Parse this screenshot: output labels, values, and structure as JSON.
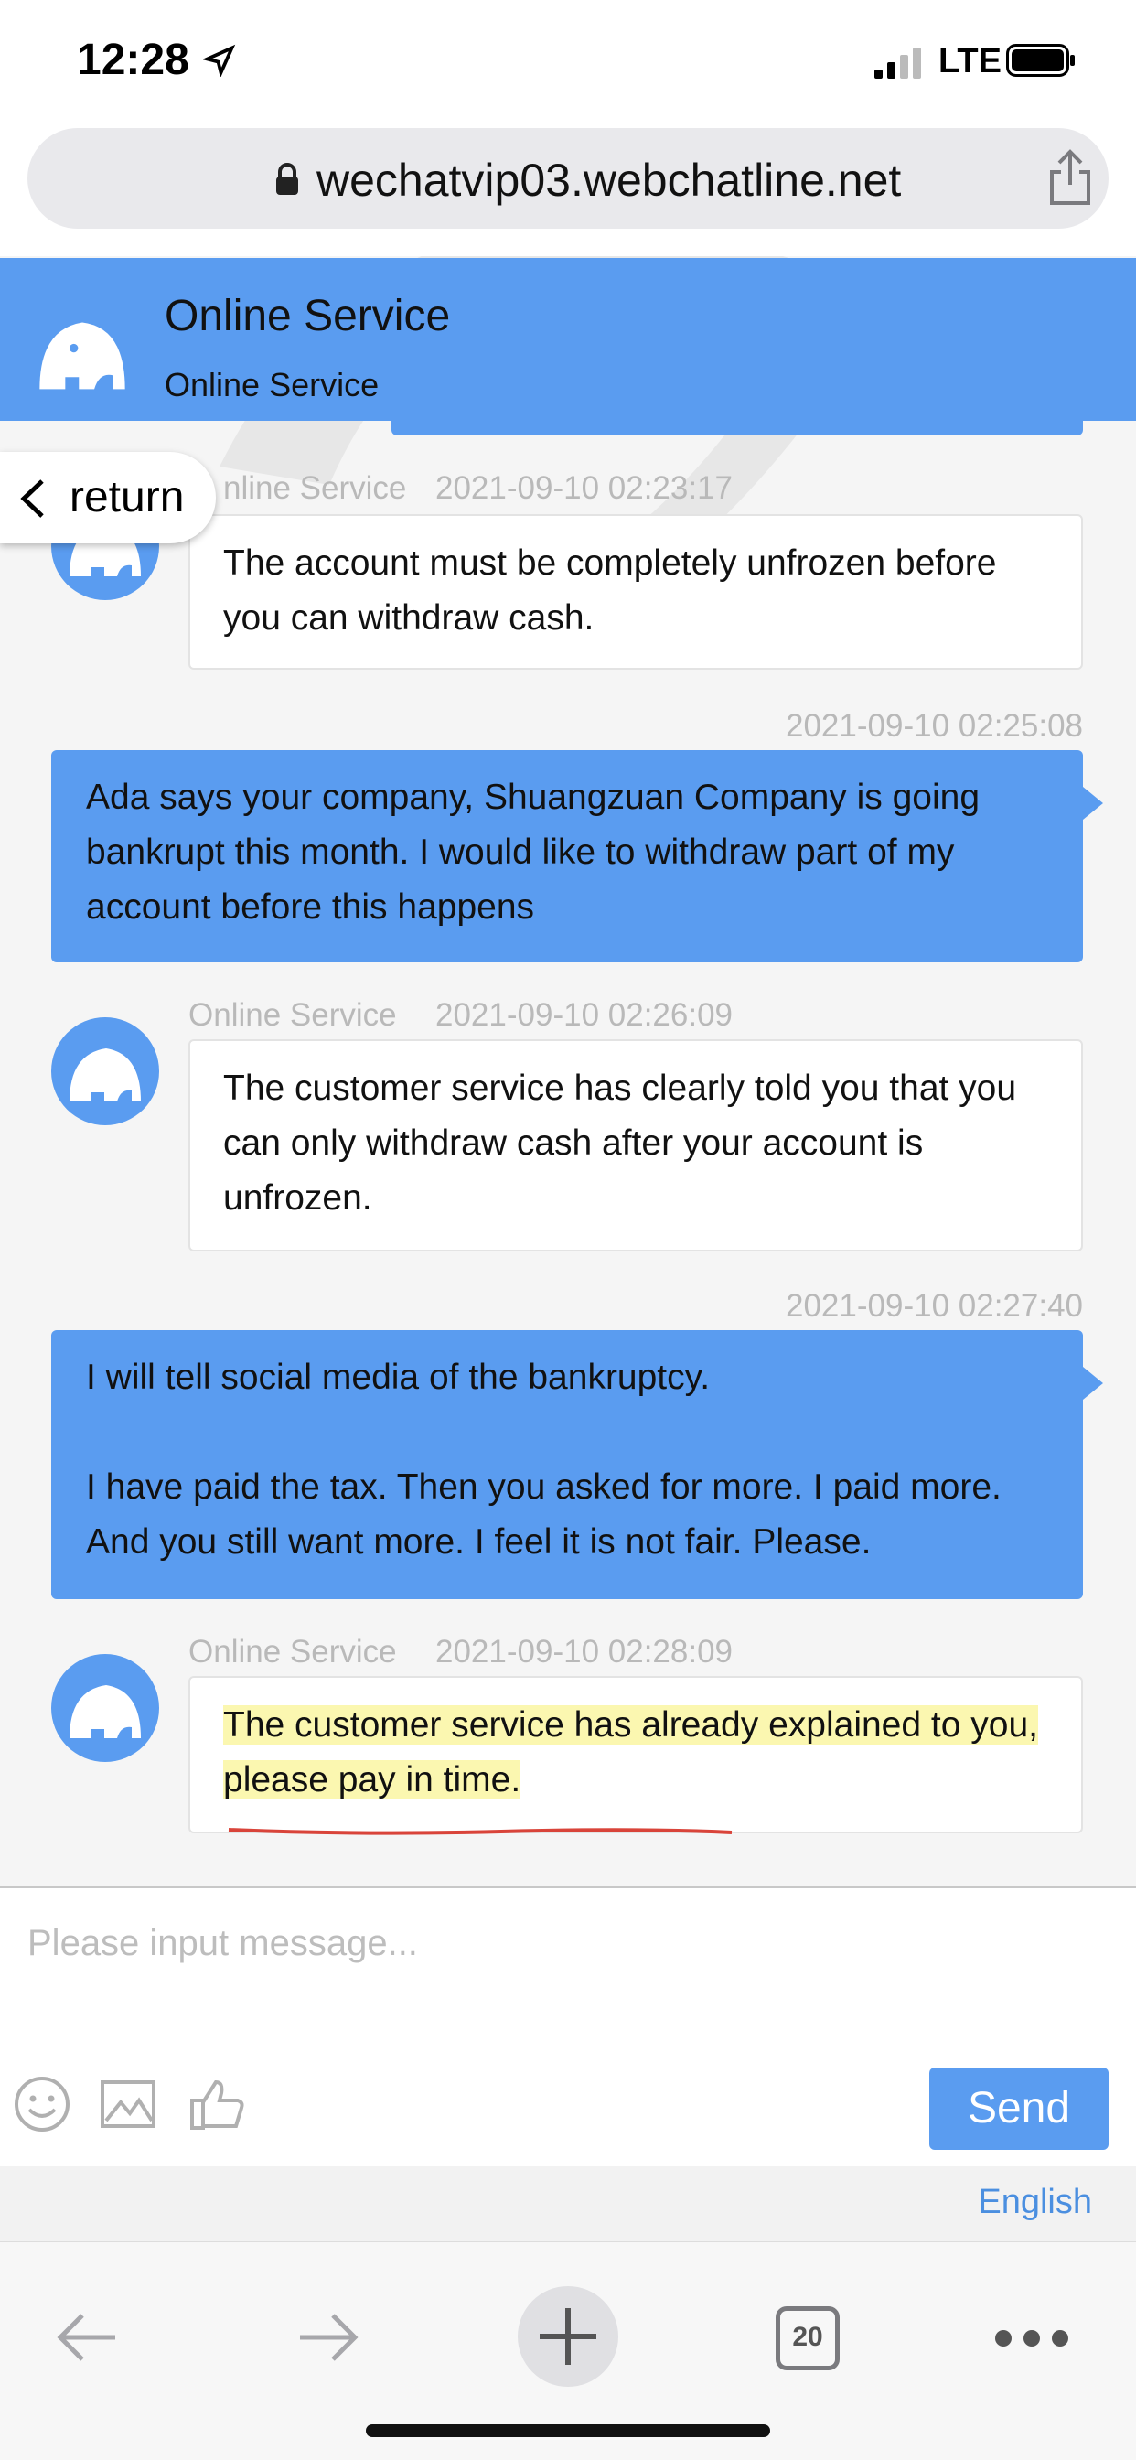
{
  "status_bar": {
    "time": "12:28",
    "network": "LTE"
  },
  "browser": {
    "url": "wechatvip03.webchatline.net",
    "tab_count": "20"
  },
  "header": {
    "title": "Online Service",
    "subtitle": "Online Service"
  },
  "return_label": "return",
  "messages": [
    {
      "side": "left",
      "sender": "nline Service",
      "time": "2021-09-10 02:23:17",
      "text": "The account must be completely unfrozen before you can withdraw cash."
    },
    {
      "side": "right",
      "time": "2021-09-10 02:25:08",
      "text": "Ada says your company, Shuangzuan Company is going bankrupt this month. I would like to withdraw part of my account before this happens"
    },
    {
      "side": "left",
      "sender": "Online Service",
      "time": "2021-09-10 02:26:09",
      "text": "The customer service has clearly told you that you can only withdraw cash after your account is unfrozen."
    },
    {
      "side": "right",
      "time": "2021-09-10 02:27:40",
      "text_line1": "I will tell social media of the bankruptcy.",
      "text_line2": "I have paid the tax. Then you asked for more. I paid more. And you still want more. I feel it is not fair. Please."
    },
    {
      "side": "left",
      "sender": "Online Service",
      "time": "2021-09-10 02:28:09",
      "text": "The customer service has already explained to you, please pay in time.",
      "highlighted": true
    }
  ],
  "input": {
    "placeholder": "Please input message..."
  },
  "send_label": "Send",
  "language_label": "English",
  "colors": {
    "accent": "#5a9cf0",
    "highlight": "#fbf7b0",
    "underline": "#d9443a"
  },
  "icons": [
    "location-arrow-icon",
    "signal-icon",
    "battery-icon",
    "lock-icon",
    "share-icon",
    "elephant-avatar-icon",
    "chevron-left-icon",
    "emoji-icon",
    "image-icon",
    "thumbs-up-icon",
    "back-arrow-icon",
    "forward-arrow-icon",
    "plus-icon",
    "tabs-icon",
    "more-icon"
  ]
}
